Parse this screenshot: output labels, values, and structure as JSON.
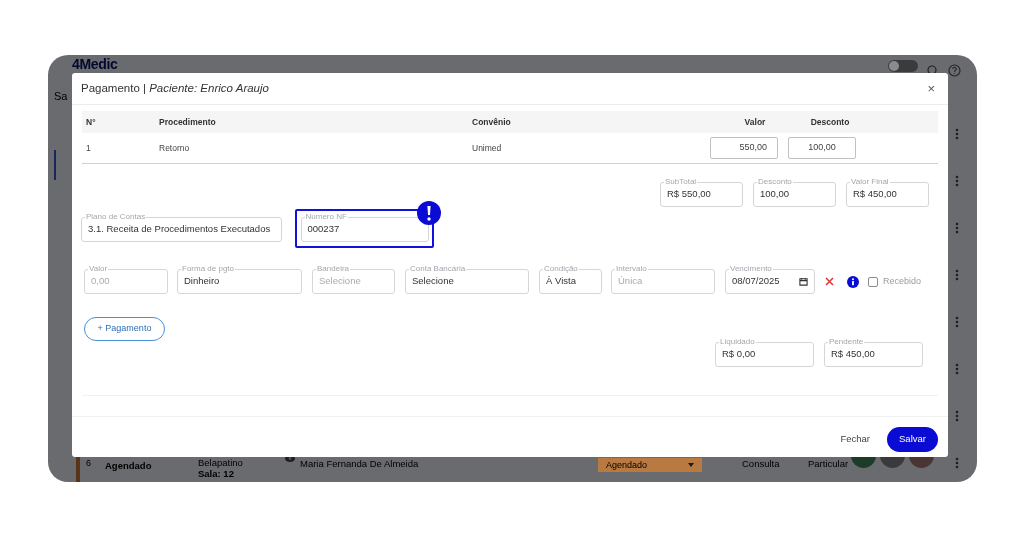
{
  "background_app": {
    "logo": "4Medic",
    "sidebar_label": "Sa",
    "theme_toggle": {
      "on": false
    },
    "row": {
      "number": "6",
      "status": "Agendado",
      "professional": "Belapatino",
      "room": "Sala: 12",
      "patient": "Maria Fernanda De Almeida",
      "status_select": "Agendado",
      "type": "Consulta",
      "plan": "Particular"
    }
  },
  "dialog": {
    "title": "Pagamento | *Paciente: Enrico Araujo*",
    "close_icon": "×",
    "table": {
      "columns": [
        "N°",
        "Procedimento",
        "Convênio",
        "Valor",
        "Desconto"
      ],
      "rows": [
        {
          "number": "1",
          "procedure": "Retorno",
          "insurance": "Unimed",
          "value": "550,00",
          "discount": "100,00"
        }
      ]
    },
    "totals": [
      {
        "label": "SubTotal",
        "value": "R$ 550,00"
      },
      {
        "label": "Desconto",
        "value": "100,00"
      },
      {
        "label": "Valor Final",
        "value": "R$ 450,00"
      }
    ],
    "account_plan": {
      "label": "Plano de Contas",
      "value": "3.1. Receita de Procedimentos Executados"
    },
    "invoice_number": {
      "label": "Número NF",
      "value": "000237",
      "highlighted": true
    },
    "payment_fields": [
      {
        "kind": "text",
        "label": "Valor",
        "placeholder": "0,00"
      },
      {
        "kind": "text",
        "label": "Forma de pgto",
        "value": "Dinheiro"
      },
      {
        "kind": "text",
        "label": "Bandeira",
        "placeholder": "Selecione"
      },
      {
        "kind": "text",
        "label": "Conta Bancária",
        "value": "Selecione"
      },
      {
        "kind": "text",
        "label": "Condição",
        "value": "À Vista"
      },
      {
        "kind": "text",
        "label": "Intervalo",
        "placeholder": "Única"
      },
      {
        "kind": "date",
        "label": "Vencimento",
        "value": "08/07/2025"
      }
    ],
    "received": {
      "label": "Recebido",
      "checked": false
    },
    "add_payment": "+ Pagamento",
    "balances": [
      {
        "label": "Liquidado",
        "value": "R$ 0,00"
      },
      {
        "label": "Pendente",
        "value": "R$ 450,00"
      }
    ],
    "buttons": {
      "close": "Fechar",
      "save": "Salvar"
    }
  }
}
